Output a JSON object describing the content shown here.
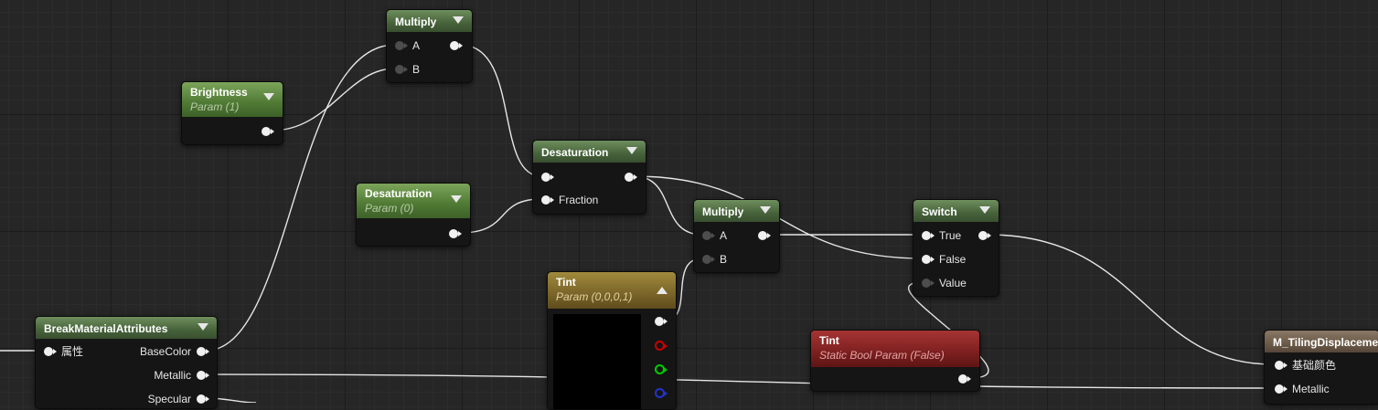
{
  "nodes": {
    "multiply_top": {
      "title": "Multiply",
      "pin_a": "A",
      "pin_b": "B"
    },
    "brightness": {
      "title": "Brightness",
      "subtitle": "Param (1)"
    },
    "desaturation_param": {
      "title": "Desaturation",
      "subtitle": "Param (0)"
    },
    "desaturation": {
      "title": "Desaturation",
      "pin_fraction": "Fraction"
    },
    "multiply_mid": {
      "title": "Multiply",
      "pin_a": "A",
      "pin_b": "B"
    },
    "switch": {
      "title": "Switch",
      "pin_true": "True",
      "pin_false": "False",
      "pin_value": "Value"
    },
    "tint_vector": {
      "title": "Tint",
      "subtitle": "Param (0,0,0,1)"
    },
    "tint_bool": {
      "title": "Tint",
      "subtitle": "Static Bool Param (False)"
    },
    "break_material": {
      "title": "BreakMaterialAttributes",
      "input_label": "属性",
      "outputs": [
        "BaseColor",
        "Metallic",
        "Specular"
      ]
    },
    "result": {
      "title": "M_TilingDisplacement",
      "inputs": [
        "基础颜色",
        "Metallic"
      ]
    }
  },
  "colors": {
    "wire": "#e6e6e6",
    "pin_red": "#cc0000",
    "pin_green": "#00cc00",
    "pin_blue": "#2233cc"
  }
}
